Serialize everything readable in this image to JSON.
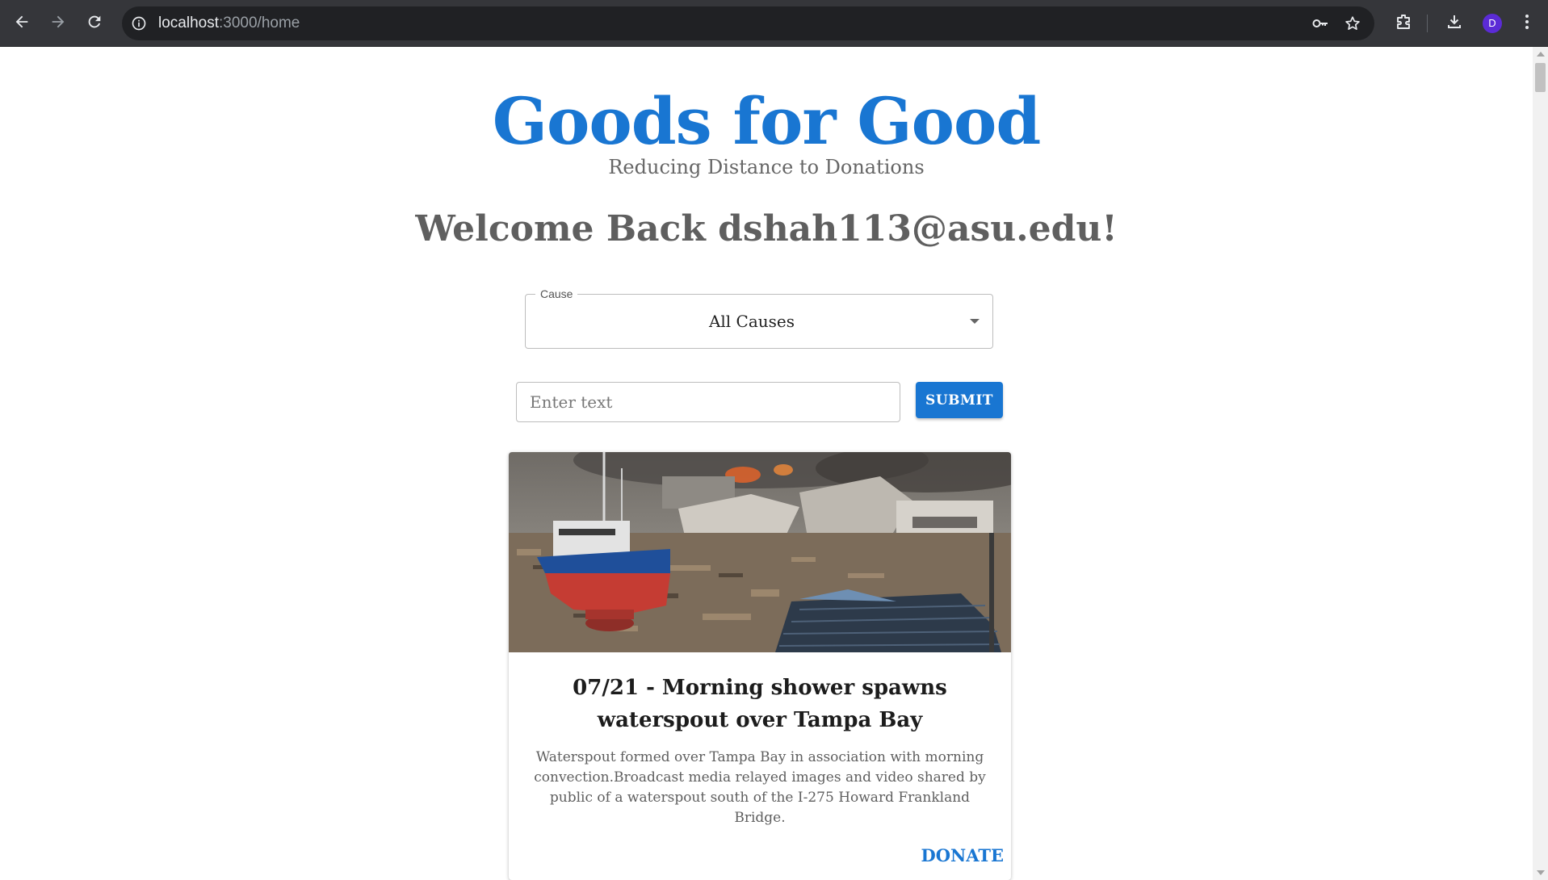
{
  "browser": {
    "url_host": "localhost",
    "url_path": ":3000/home",
    "profile_initial": "D"
  },
  "header": {
    "title": "Goods for Good",
    "tagline": "Reducing Distance to Donations",
    "welcome": "Welcome Back dshah113@asu.edu!"
  },
  "filter": {
    "cause_label": "Cause",
    "cause_value": "All Causes"
  },
  "search": {
    "placeholder": "Enter text",
    "submit_label": "SUBMIT"
  },
  "card": {
    "title": "07/21 - Morning shower spawns waterspout over Tampa Bay",
    "body": "Waterspout formed over Tampa Bay in association with morning convection.Broadcast media relayed images and video shared by public of a waterspout south of the I-275 Howard Frankland Bridge.",
    "donate_label": "DONATE"
  },
  "colors": {
    "brand": "#1976d2",
    "chrome_bg": "#35363a",
    "omnibox_bg": "#202124"
  }
}
